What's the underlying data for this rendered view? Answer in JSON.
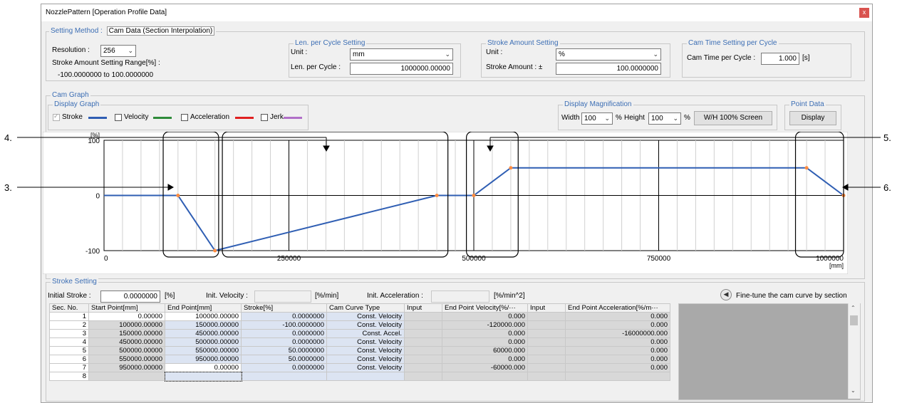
{
  "window": {
    "title": "NozzlePattern [Operation Profile Data]",
    "close_label": "x"
  },
  "setting_method": {
    "label": "Setting Method :",
    "value": "Cam Data (Section Interpolation)",
    "resolution_label": "Resolution :",
    "resolution_value": "256",
    "range_label": "Stroke Amount Setting Range[%] :",
    "range_value": "-100.0000000 to 100.0000000"
  },
  "len_cycle": {
    "group_label": "Len. per Cycle Setting",
    "unit_label": "Unit :",
    "unit_value": "mm",
    "len_label": "Len. per Cycle :",
    "len_value": "1000000.00000"
  },
  "stroke_setting_top": {
    "group_label": "Stroke Amount Setting",
    "unit_label": "Unit :",
    "unit_value": "%",
    "amount_label": "Stroke Amount : ±",
    "amount_value": "100.0000000"
  },
  "cam_time": {
    "group_label": "Cam Time Setting per Cycle",
    "label": "Cam Time per Cycle :",
    "value": "1.000",
    "unit": "[s]"
  },
  "cam_graph": {
    "group_label": "Cam Graph",
    "display_graph_label": "Display Graph",
    "stroke_label": "Stroke",
    "velocity_label": "Velocity",
    "acceleration_label": "Acceleration",
    "jerk_label": "Jerk",
    "colors": {
      "stroke": "#2f5eb3",
      "velocity": "#2e8b3a",
      "acceleration": "#e02020",
      "jerk": "#b070c8"
    },
    "magnification_label": "Display Magnification",
    "width_label": "Width",
    "width_value": "100",
    "pct": "%",
    "height_label": "Height",
    "height_value": "100",
    "wh_button": "W/H 100% Screen",
    "point_data_label": "Point Data",
    "display_button": "Display"
  },
  "chart_data": {
    "type": "line",
    "y_unit": "[%]",
    "x_unit": "[mm]",
    "xlim": [
      0,
      1000000
    ],
    "ylim": [
      -100,
      100
    ],
    "x_ticks": [
      "0",
      "250000",
      "500000",
      "750000",
      "1000000"
    ],
    "y_ticks": [
      "100",
      "0",
      "-100"
    ],
    "series": [
      {
        "x": [
          0,
          100000,
          150000,
          450000,
          500000,
          550000,
          950000,
          1000000
        ],
        "y": [
          0,
          0,
          -100,
          0,
          0,
          50,
          50,
          0
        ]
      }
    ],
    "points_x": [
      100000,
      150000,
      450000,
      500000,
      550000,
      950000,
      1000000
    ]
  },
  "callouts": [
    "3.",
    "4.",
    "5.",
    "6."
  ],
  "stroke_setting": {
    "group_label": "Stroke Setting",
    "initial_label": "Initial Stroke :",
    "initial_value": "0.0000000",
    "initial_unit": "[%]",
    "velocity_label": "Init. Velocity :",
    "velocity_unit": "[%/min]",
    "accel_label": "Init. Acceleration :",
    "accel_unit": "[%/min^2]",
    "finetune_label": "Fine-tune the cam curve by section"
  },
  "table": {
    "headers": [
      "Sec. No.",
      "Start Point[mm]",
      "End Point[mm]",
      "Stroke[%]",
      "Cam Curve Type",
      "Input",
      "End Point Velocity[%/···",
      "Input",
      "End Point Acceleration[%/m···"
    ],
    "rows": [
      [
        "1",
        "0.00000",
        "100000.00000",
        "0.0000000",
        "Const. Velocity",
        "",
        "0.000",
        "",
        "0.000"
      ],
      [
        "2",
        "100000.00000",
        "150000.00000",
        "-100.0000000",
        "Const. Velocity",
        "",
        "-120000.000",
        "",
        "0.000"
      ],
      [
        "3",
        "150000.00000",
        "450000.00000",
        "0.0000000",
        "Const. Accel.",
        "",
        "0.000",
        "",
        "-16000000.000"
      ],
      [
        "4",
        "450000.00000",
        "500000.00000",
        "0.0000000",
        "Const. Velocity",
        "",
        "0.000",
        "",
        "0.000"
      ],
      [
        "5",
        "500000.00000",
        "550000.00000",
        "50.0000000",
        "Const. Velocity",
        "",
        "60000.000",
        "",
        "0.000"
      ],
      [
        "6",
        "550000.00000",
        "950000.00000",
        "50.0000000",
        "Const. Velocity",
        "",
        "0.000",
        "",
        "0.000"
      ],
      [
        "7",
        "950000.00000",
        "0.00000",
        "0.0000000",
        "Const. Velocity",
        "",
        "-60000.000",
        "",
        "0.000"
      ],
      [
        "8",
        "",
        "",
        "",
        "",
        "",
        "",
        "",
        ""
      ]
    ]
  }
}
